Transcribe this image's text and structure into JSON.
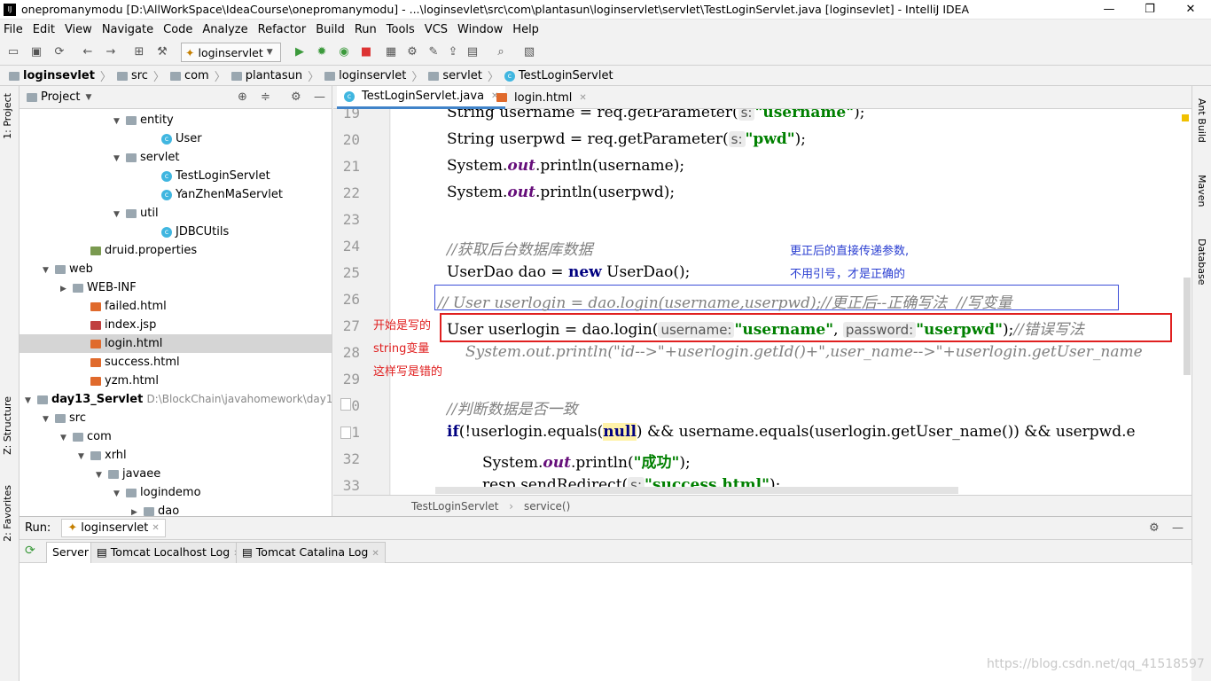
{
  "window": {
    "title": "onepromanymodu [D:\\AllWorkSpace\\IdeaCourse\\onepromanymodu] - ...\\loginsevlet\\src\\com\\plantasun\\loginservlet\\servlet\\TestLoginServlet.java [loginsevlet] - IntelliJ IDEA",
    "minimize": "—",
    "maximize": "❐",
    "close": "✕"
  },
  "menu": [
    "File",
    "Edit",
    "View",
    "Navigate",
    "Code",
    "Analyze",
    "Refactor",
    "Build",
    "Run",
    "Tools",
    "VCS",
    "Window",
    "Help"
  ],
  "toolbar": {
    "run_config": "loginservlet"
  },
  "breadcrumb": [
    "loginsevlet",
    "src",
    "com",
    "plantasun",
    "loginservlet",
    "servlet",
    "TestLoginServlet"
  ],
  "side_tabs": {
    "left": [
      "1: Project",
      "Z: Structure",
      "2: Favorites"
    ],
    "right": [
      "Ant Build",
      "Maven",
      "Database"
    ]
  },
  "project": {
    "title": "Project",
    "tree": [
      {
        "label": "entity",
        "kind": "folder",
        "depth": 5,
        "open": true
      },
      {
        "label": "User",
        "kind": "class",
        "depth": 7
      },
      {
        "label": "servlet",
        "kind": "folder",
        "depth": 5,
        "open": true
      },
      {
        "label": "TestLoginServlet",
        "kind": "class",
        "depth": 7
      },
      {
        "label": "YanZhenMaServlet",
        "kind": "class",
        "depth": 7
      },
      {
        "label": "util",
        "kind": "folder",
        "depth": 5,
        "open": true
      },
      {
        "label": "JDBCUtils",
        "kind": "class",
        "depth": 7
      },
      {
        "label": "druid.properties",
        "kind": "file",
        "depth": 3
      },
      {
        "label": "web",
        "kind": "folder",
        "depth": 1,
        "open": true
      },
      {
        "label": "WEB-INF",
        "kind": "folder",
        "depth": 2,
        "open": false
      },
      {
        "label": "failed.html",
        "kind": "html",
        "depth": 3
      },
      {
        "label": "index.jsp",
        "kind": "jsp",
        "depth": 3
      },
      {
        "label": "login.html",
        "kind": "html",
        "depth": 3,
        "selected": true
      },
      {
        "label": "success.html",
        "kind": "html",
        "depth": 3
      },
      {
        "label": "yzm.html",
        "kind": "html",
        "depth": 3
      },
      {
        "label": "day13_Servlet",
        "kind": "module",
        "depth": 0,
        "open": true,
        "path": "D:\\BlockChain\\javahomework\\day13_S"
      },
      {
        "label": "src",
        "kind": "folder",
        "depth": 1,
        "open": true
      },
      {
        "label": "com",
        "kind": "folder",
        "depth": 2,
        "open": true
      },
      {
        "label": "xrhl",
        "kind": "folder",
        "depth": 3,
        "open": true
      },
      {
        "label": "javaee",
        "kind": "folder",
        "depth": 4,
        "open": true
      },
      {
        "label": "logindemo",
        "kind": "folder",
        "depth": 5,
        "open": true
      },
      {
        "label": "dao",
        "kind": "folder",
        "depth": 6,
        "open": false
      }
    ]
  },
  "editor": {
    "tabs": [
      {
        "label": "TestLoginServlet.java",
        "active": true
      },
      {
        "label": "login.html",
        "active": false
      }
    ],
    "line_numbers": [
      "19",
      "20",
      "21",
      "22",
      "23",
      "24",
      "25",
      "26",
      "27",
      "28",
      "29",
      "30",
      "31",
      "32",
      "33"
    ],
    "code": {
      "l19a": "String username = req.getParameter(",
      "l19h": "s:",
      "l19s": "\"username\"",
      "l19b": ");",
      "l20a": "String userpwd = req.getParameter(",
      "l20h": "s:",
      "l20s": "\"pwd\"",
      "l20b": ");",
      "l21a": "System.",
      "l21f": "out",
      "l21b": ".println(username);",
      "l22a": "System.",
      "l22f": "out",
      "l22b": ".println(userpwd);",
      "l24": "//获取后台数据库数据",
      "l25a": "UserDao dao = ",
      "l25k": "new",
      "l25b": " UserDao();",
      "l26": "// User userlogin = dao.login(username,userpwd);//更正后--正确写法  //写变量",
      "l27a": "User userlogin = dao.login(",
      "l27h1": "username:",
      "l27s1": "\"username\"",
      "l27c": ", ",
      "l27h2": "password:",
      "l27s2": "\"userpwd\"",
      "l27b": ");",
      "l27cm": "//错误写法",
      "l28": "System.out.println(\"id-->\"+userlogin.getId()+\",user_name-->\"+userlogin.getUser_name",
      "l30": "//判断数据是否一致",
      "l31k": "if",
      "l31a": "(!userlogin.equals(",
      "l31n": "null",
      "l31b": ") && username.equals(userlogin.getUser_name()) && userpwd.e",
      "l32a": "System.",
      "l32f": "out",
      "l32b": ".println(",
      "l32s": "\"成功\"",
      "l32c": ");",
      "l33a": "resp.sendRedirect(",
      "l33h": "s:",
      "l33s": "\"success.html\"",
      "l33b": ");"
    },
    "annotations": {
      "blue_line1": "更正后的直接传递参数,",
      "blue_line2": "不用引号，才是正确的",
      "red_line1": "开始是写的",
      "red_line2": "string变量",
      "red_line3": "这样写是错的"
    },
    "breadcrumb": [
      "TestLoginServlet",
      "service()"
    ]
  },
  "run": {
    "label": "Run:",
    "config": "loginservlet",
    "tabs": [
      "Server",
      "Tomcat Localhost Log",
      "Tomcat Catalina Log"
    ]
  },
  "watermark": "https://blog.csdn.net/qq_41518597",
  "colors": {
    "keyword": "#000080",
    "string": "#008000",
    "comment": "#808080",
    "annotation_red": "#e02020",
    "annotation_blue": "#2a3ed1"
  }
}
